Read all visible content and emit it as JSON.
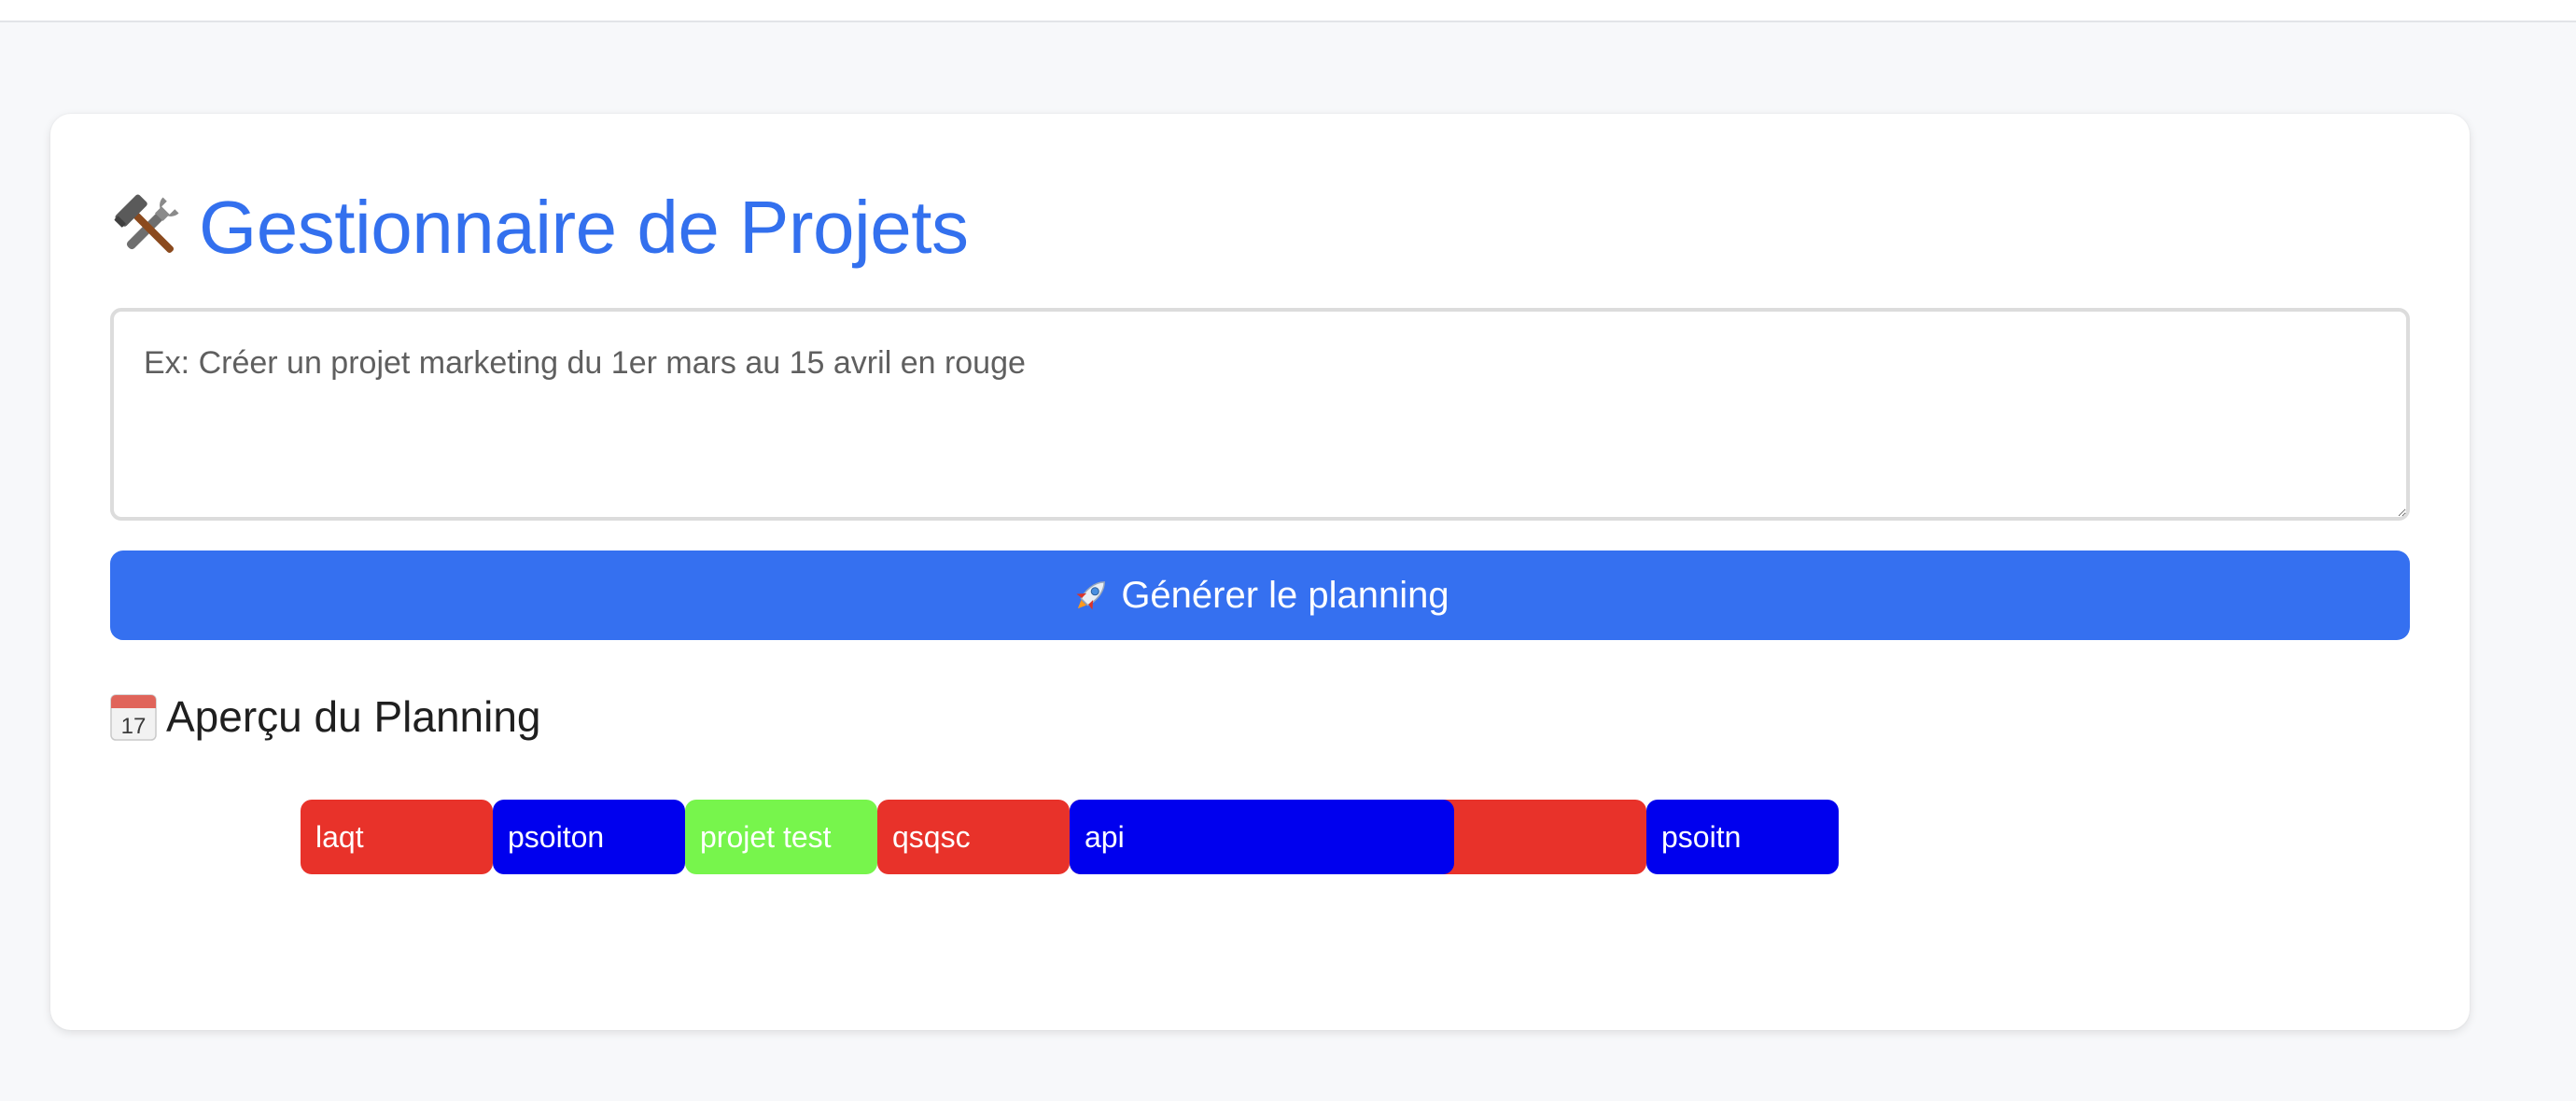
{
  "header": {
    "title": "Gestionnaire de Projets",
    "icon": "hammer-and-wrench-icon"
  },
  "prompt": {
    "placeholder": "Ex: Créer un projet marketing du 1er mars au 15 avril en rouge",
    "value": ""
  },
  "generate_button": {
    "label": "Générer le planning",
    "icon": "rocket-icon",
    "color": "#3570f0"
  },
  "planning": {
    "title": "Aperçu du Planning",
    "icon": "calendar-icon",
    "projects": [
      {
        "name": "laqt",
        "color": "#e8322a",
        "start": 0,
        "end": 1
      },
      {
        "name": "psoiton",
        "color": "#0000ee",
        "start": 1,
        "end": 2
      },
      {
        "name": "projet test",
        "color": "#77f54c",
        "start": 2,
        "end": 3
      },
      {
        "name": "qsqsc",
        "color": "#e8322a",
        "start": 3,
        "end": 4
      },
      {
        "name": "",
        "color": "#e8322a",
        "start": 4,
        "end": 7
      },
      {
        "name": "api",
        "color": "#0000ee",
        "start": 4,
        "end": 6
      },
      {
        "name": "psoitn",
        "color": "#0000ee",
        "start": 7,
        "end": 8
      }
    ]
  }
}
